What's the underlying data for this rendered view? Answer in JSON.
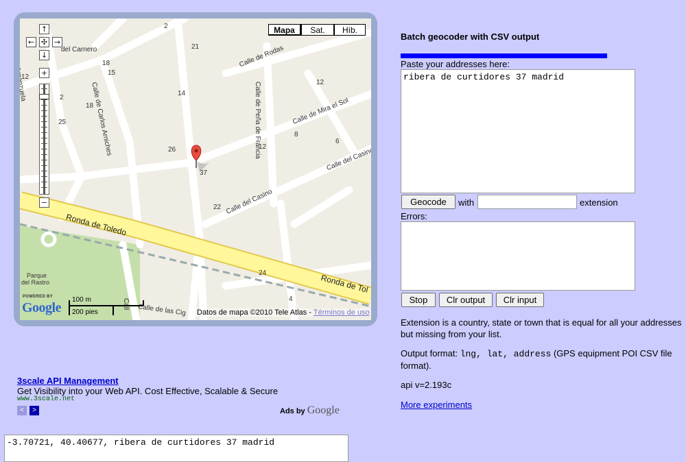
{
  "map": {
    "type_buttons": {
      "map": "Mapa",
      "satellite": "Sat.",
      "hybrid": "Híb."
    },
    "streets": {
      "carnero": "del Carnero",
      "carlos_arniches": "Calle de Carlos Arniches",
      "rodas": "Calle de Rodas",
      "arganzuela": "la Arganzuela",
      "mira_el_sol": "Calle de Mira el Sol",
      "pena_de_francia": "Calle de Peña de Francia",
      "casino_1": "Calle del Casino",
      "casino_2": "Calle del Casino",
      "ronda_toledo_1": "Ronda de Toledo",
      "ronda_toledo_2": "Ronda de Tol",
      "las_cig": "Calle de las Cig",
      "call": "Call",
      "parque": "Parque",
      "del_rastro": "del Rastro"
    },
    "numbers": [
      "2",
      "12",
      "21",
      "14",
      "18",
      "15",
      "2",
      "18",
      "25",
      "26",
      "37",
      "12",
      "12",
      "8",
      "6",
      "22",
      "24",
      "4"
    ],
    "copyright_text": "Datos de mapa ©2010 Tele Atlas - ",
    "terms_link": "Términos de uso",
    "scale_metric": "100 m",
    "scale_imperial": "200 pies",
    "powered_by": "POWERED BY",
    "google": "Google",
    "nav_glyphs": {
      "up": "↑",
      "left": "←",
      "center": "✣",
      "right": "→",
      "down": "↓",
      "zoom_in": "+",
      "zoom_out": "−"
    }
  },
  "panel": {
    "title": "Batch geocoder with CSV output",
    "progress_fraction": 1.0,
    "paste_label": "Paste your addresses here:",
    "addresses_value": "ribera de curtidores 37 madrid",
    "geocode_button": "Geocode",
    "with_label": "with",
    "extension_value": "",
    "extension_label": "extension",
    "errors_label": "Errors:",
    "errors_value": "",
    "stop_button": "Stop",
    "clr_output_button": "Clr output",
    "clr_input_button": "Clr input",
    "extension_help": "Extension is a country, state or town that is equal for all your addresses but missing from your list.",
    "output_format_prefix": "Output format: ",
    "output_format_code": "lng, lat, address",
    "output_format_suffix": " (GPS equipment POI CSV file format).",
    "api_version": "api v=2.193c",
    "more_experiments": "More experiments"
  },
  "ad": {
    "title": "3scale API Management",
    "description": "Get Visibility into your Web API. Cost Effective, Scalable & Secure",
    "url": "www.3scale.net",
    "prev_glyph": "<",
    "next_glyph": ">",
    "ads_by": "Ads by ",
    "ads_by_brand": "Google"
  },
  "output": {
    "value": "-3.70721, 40.40677, ribera de curtidores 37 madrid"
  },
  "colors": {
    "background": "#ccccff",
    "progress": "#0000ff",
    "link": "#0000cc",
    "marker": "#e84c3d",
    "major_road": "#fff799"
  }
}
